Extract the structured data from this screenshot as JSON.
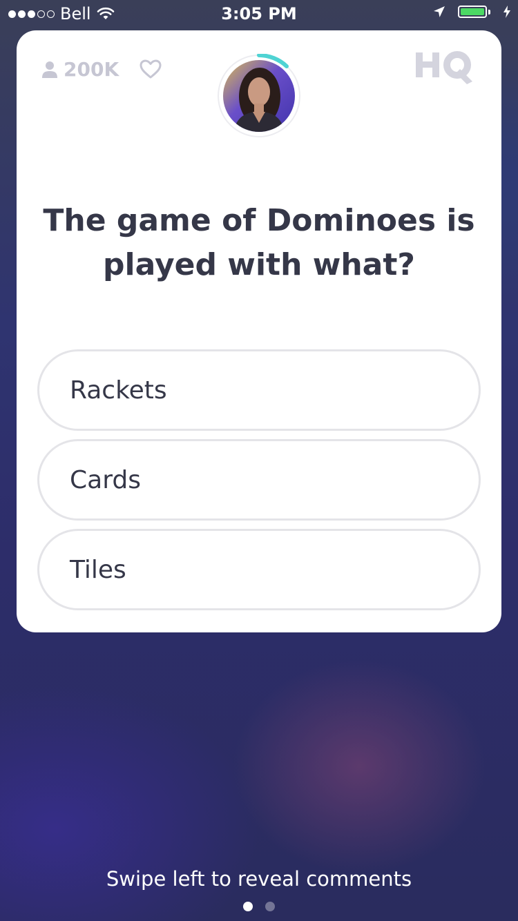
{
  "status_bar": {
    "carrier": "Bell",
    "time": "3:05 PM",
    "signal_bars_filled": 3,
    "signal_bars_total": 5,
    "battery_color": "#4cd964"
  },
  "header": {
    "viewer_count": "200K",
    "logo_text": "HQ",
    "icons": [
      "person-icon",
      "heart-icon"
    ]
  },
  "question": {
    "text": "The game of Dominoes is played with what?"
  },
  "answers": [
    {
      "label": "Rackets"
    },
    {
      "label": "Cards"
    },
    {
      "label": "Tiles"
    }
  ],
  "footer": {
    "hint": "Swipe left to reveal comments",
    "page_count": 2,
    "active_page": 1
  },
  "colors": {
    "text_dark": "#353748",
    "muted": "#c6c6d3",
    "answer_border": "#e4e4e8",
    "timer_ring": "#4fd3d3"
  }
}
